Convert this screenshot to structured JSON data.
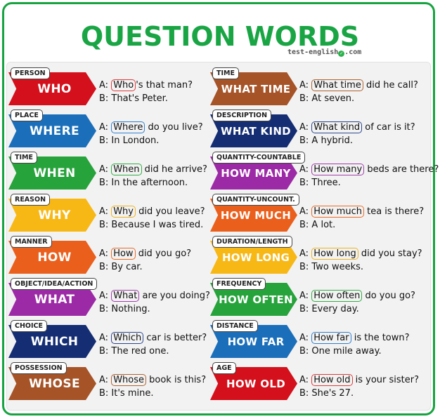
{
  "title": "QUESTION WORDS",
  "brand": "test-english",
  "brand_suffix": ".com",
  "left": [
    {
      "tag": "PERSON",
      "word": "WHO",
      "color": "#d3101b",
      "hl": "#e23b3b",
      "a_pre": "A: ",
      "a_hl": "Who",
      "a_post": "'s that man?",
      "b": "B: That's Peter."
    },
    {
      "tag": "PLACE",
      "word": "WHERE",
      "color": "#1b6fba",
      "hl": "#2d7fd0",
      "a_pre": "A: ",
      "a_hl": "Where",
      "a_post": " do you live?",
      "b": "B: In London."
    },
    {
      "tag": "TIME",
      "word": "WHEN",
      "color": "#27a33b",
      "hl": "#2fae44",
      "a_pre": "A: ",
      "a_hl": "When",
      "a_post": " did he arrive?",
      "b": "B: In the afternoon."
    },
    {
      "tag": "REASON",
      "word": "WHY",
      "color": "#f7b816",
      "hl": "#f0b31b",
      "a_pre": "A: ",
      "a_hl": "Why",
      "a_post": " did you leave?",
      "b": "B: Because I was tired."
    },
    {
      "tag": "MANNER",
      "word": "HOW",
      "color": "#ea5f1c",
      "hl": "#ea6a24",
      "a_pre": "A: ",
      "a_hl": "How",
      "a_post": " did you go?",
      "b": "B: By car."
    },
    {
      "tag": "OBJECT/IDEA/ACTION",
      "word": "WHAT",
      "color": "#9c2aa6",
      "hl": "#a33aad",
      "a_pre": "A: ",
      "a_hl": "What",
      "a_post": " are you doing?",
      "b": "B: Nothing."
    },
    {
      "tag": "CHOICE",
      "word": "WHICH",
      "color": "#142d73",
      "hl": "#2a4590",
      "a_pre": "A: ",
      "a_hl": "Which",
      "a_post": " car is better?",
      "b": "B: The red one."
    },
    {
      "tag": "POSSESSION",
      "word": "WHOSE",
      "color": "#a55327",
      "hl": "#b0622f",
      "a_pre": "A: ",
      "a_hl": "Whose",
      "a_post": " book is this?",
      "b": "B: It's mine."
    }
  ],
  "right": [
    {
      "tag": "TIME",
      "word": "WHAT TIME",
      "color": "#a55327",
      "hl": "#b0622f",
      "a_pre": "A: ",
      "a_hl": "What time",
      "a_post": " did he call?",
      "b": "B: At seven."
    },
    {
      "tag": "DESCRIPTION",
      "word": "WHAT KIND",
      "color": "#142d73",
      "hl": "#2a4590",
      "a_pre": "A: ",
      "a_hl": "What kind",
      "a_post": " of car is it?",
      "b": "B: A hybrid."
    },
    {
      "tag": "QUANTITY-COUNTABLE",
      "word": "HOW MANY",
      "color": "#9c2aa6",
      "hl": "#a33aad",
      "a_pre": "A: ",
      "a_hl": "How many",
      "a_post": " beds are there?",
      "b": "B: Three."
    },
    {
      "tag": "QUANTITY-UNCOUNT.",
      "word": "HOW MUCH",
      "color": "#ea5f1c",
      "hl": "#ea6a24",
      "a_pre": "A: ",
      "a_hl": "How much",
      "a_post": " tea is there?",
      "b": "B: A lot."
    },
    {
      "tag": "DURATION/LENGTH",
      "word": "HOW LONG",
      "color": "#f7b816",
      "hl": "#f0b31b",
      "a_pre": "A: ",
      "a_hl": "How long",
      "a_post": " did you stay?",
      "b": "B: Two weeks."
    },
    {
      "tag": "FREQUENCY",
      "word": "HOW OFTEN",
      "color": "#27a33b",
      "hl": "#2fae44",
      "a_pre": "A: ",
      "a_hl": "How often",
      "a_post": " do you go?",
      "b": "B: Every day."
    },
    {
      "tag": "DISTANCE",
      "word": "HOW FAR",
      "color": "#1b6fba",
      "hl": "#2d7fd0",
      "a_pre": "A: ",
      "a_hl": "How far",
      "a_post": " is the town?",
      "b": "B: One mile away."
    },
    {
      "tag": "AGE",
      "word": "HOW OLD",
      "color": "#d3101b",
      "hl": "#e23b3b",
      "a_pre": "A: ",
      "a_hl": "How old",
      "a_post": " is your sister?",
      "b": "B: She's 27."
    }
  ]
}
